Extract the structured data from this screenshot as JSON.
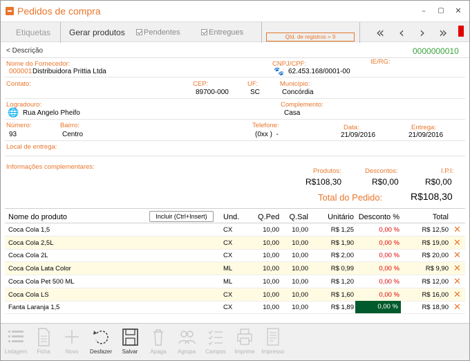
{
  "window": {
    "title": "Pedidos de compra",
    "min": "–",
    "max": "▢",
    "close": "✕"
  },
  "toolbar": {
    "etiquetas": "Etiquetas",
    "gerar": "Gerar produtos",
    "pendentes": "Pendentes",
    "entregues": "Entregues",
    "qtd": "Qtd. de registros = 9",
    "nav_first": "«",
    "nav_prev": "‹",
    "nav_next": "›",
    "nav_last": "»"
  },
  "desc": {
    "back": "< Descrição",
    "code": "0000000010"
  },
  "form": {
    "fornecedor_label": "Nome do Fornecedor:",
    "fornecedor_code": "000001",
    "fornecedor_name": "Distribuidora Prittia Ltda",
    "cnpj_label": "CNPJ/CPF:",
    "cnpj": "62.453.168/0001-00",
    "ierg_label": "IE/RG:",
    "contato_label": "Contato:",
    "cep_label": "CEP:",
    "cep": "89700-000",
    "uf_label": "UF:",
    "uf": "SC",
    "municipio_label": "Município:",
    "municipio": "Concórdia",
    "logradouro_label": "Logradouro:",
    "logradouro": "Rua Angelo Pheifo",
    "complemento_label": "Complemento:",
    "complemento": "Casa",
    "numero_label": "Número:",
    "numero": "93",
    "bairro_label": "Bairro:",
    "bairro": "Centro",
    "telefone_label": "Telefone:",
    "telefone": "(0xx )  -",
    "data_label": "Data:",
    "data": "21/09/2016",
    "entrega_label": "Entrega:",
    "entrega": "21/09/2016",
    "local_label": "Local de entrega:",
    "info_label": "Informações complementares:",
    "produtos_label": "Produtos:",
    "produtos": "R$108,30",
    "descontos_label": "Descontos:",
    "descontos": "R$0,00",
    "ipi_label": "I.P.I:",
    "ipi": "R$0,00",
    "total_label": "Total do Pedido:",
    "total": "R$108,30"
  },
  "grid": {
    "headers": {
      "nome": "Nome do produto",
      "und": "Und.",
      "qped": "Q.Ped",
      "qsal": "Q.Sal",
      "unit": "Unitário",
      "desc": "Desconto %",
      "total": "Total"
    },
    "incluir": "Incluir (Ctrl+Insert)",
    "rows": [
      {
        "nome": "Coca Cola 1,5",
        "und": "CX",
        "qped": "10,00",
        "qsal": "10,00",
        "unit": "R$ 1,25",
        "desc": "0,00 %",
        "total": "R$ 12,50"
      },
      {
        "nome": "Coca Cola 2,5L",
        "und": "CX",
        "qped": "10,00",
        "qsal": "10,00",
        "unit": "R$ 1,90",
        "desc": "0,00 %",
        "total": "R$ 19,00"
      },
      {
        "nome": "Coca Cola 2L",
        "und": "CX",
        "qped": "10,00",
        "qsal": "10,00",
        "unit": "R$ 2,00",
        "desc": "0,00 %",
        "total": "R$ 20,00"
      },
      {
        "nome": "Coca Cola Lata Color",
        "und": "ML",
        "qped": "10,00",
        "qsal": "10,00",
        "unit": "R$ 0,99",
        "desc": "0,00 %",
        "total": "R$ 9,90"
      },
      {
        "nome": "Coca Cola Pet 500 ML",
        "und": "ML",
        "qped": "10,00",
        "qsal": "10,00",
        "unit": "R$ 1,20",
        "desc": "0,00 %",
        "total": "R$ 12,00"
      },
      {
        "nome": "Coca Cola LS",
        "und": "CX",
        "qped": "10,00",
        "qsal": "10,00",
        "unit": "R$ 1,60",
        "desc": "0,00 %",
        "total": "R$ 16,00"
      },
      {
        "nome": "Fanta Laranja 1,5",
        "und": "CX",
        "qped": "10,00",
        "qsal": "10,00",
        "unit": "R$ 1,89",
        "desc": "0,00 %",
        "total": "R$ 18,90"
      }
    ]
  },
  "bottom": {
    "listagem": "Listagem",
    "ficha": "Ficha",
    "novo": "Novo",
    "desfazer": "Desfazer",
    "salvar": "Salvar",
    "apaga": "Apaga",
    "agrupa": "Agrupa",
    "campos": "Campos",
    "imprime": "Imprime",
    "impresso": "Impresso"
  },
  "colors": {
    "accent": "#e8762c",
    "selected": "#005a2b",
    "code": "#3aa33a",
    "discount": "#e00000",
    "alt_row": "#fffbe3"
  }
}
